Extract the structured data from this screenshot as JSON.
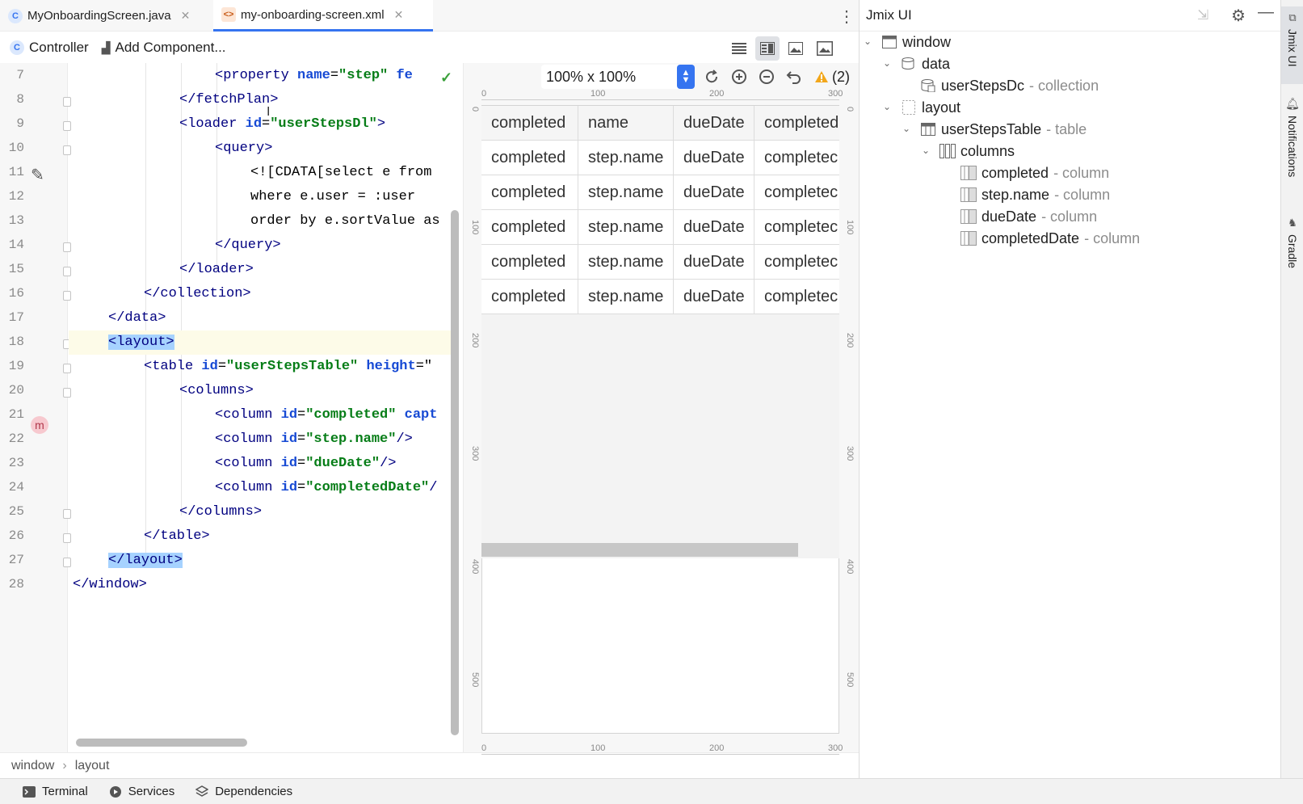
{
  "tabs": [
    {
      "label": "MyOnboardingScreen.java",
      "icon": "java-class-icon"
    },
    {
      "label": "my-onboarding-screen.xml",
      "icon": "xml-file-icon"
    }
  ],
  "toolbar": {
    "controller_label": "Controller",
    "add_component_label": "Add Component..."
  },
  "line_numbers": [
    "7",
    "8",
    "9",
    "10",
    "11",
    "12",
    "13",
    "14",
    "15",
    "16",
    "17",
    "18",
    "19",
    "20",
    "21",
    "22",
    "23",
    "24",
    "25",
    "26",
    "27",
    "28"
  ],
  "code": [
    {
      "indent": "    ",
      "parts": [
        [
          "tg",
          "<property "
        ],
        [
          "at",
          "name"
        ],
        [
          "tx",
          "="
        ],
        [
          "av",
          "\"step\""
        ],
        [
          "tx",
          " "
        ],
        [
          "at",
          "fe"
        ]
      ]
    },
    {
      "indent": "   ",
      "parts": [
        [
          "tg",
          "</fetchPlan>"
        ]
      ]
    },
    {
      "indent": "   ",
      "parts": [
        [
          "tg",
          "<loader "
        ],
        [
          "at",
          "id"
        ],
        [
          "tx",
          "="
        ],
        [
          "av",
          "\"userStepsDl\""
        ],
        [
          "tg",
          ">"
        ]
      ]
    },
    {
      "indent": "    ",
      "parts": [
        [
          "tg",
          "<query>"
        ]
      ]
    },
    {
      "indent": "     ",
      "parts": [
        [
          "tx",
          "<![CDATA[select e from"
        ]
      ]
    },
    {
      "indent": "     ",
      "parts": [
        [
          "tx",
          "where e.user = :user"
        ]
      ]
    },
    {
      "indent": "     ",
      "parts": [
        [
          "tx",
          "order by e.sortValue as"
        ]
      ]
    },
    {
      "indent": "    ",
      "parts": [
        [
          "tg",
          "</query>"
        ]
      ]
    },
    {
      "indent": "   ",
      "parts": [
        [
          "tg",
          "</loader>"
        ]
      ]
    },
    {
      "indent": "  ",
      "parts": [
        [
          "tg",
          "</collection>"
        ]
      ]
    },
    {
      "indent": " ",
      "parts": [
        [
          "tg",
          "</data>"
        ]
      ]
    },
    {
      "indent": " ",
      "parts": [
        [
          "tg",
          "<layout>"
        ]
      ]
    },
    {
      "indent": "  ",
      "parts": [
        [
          "tg",
          "<table "
        ],
        [
          "at",
          "id"
        ],
        [
          "tx",
          "="
        ],
        [
          "av",
          "\"userStepsTable\""
        ],
        [
          "tx",
          " "
        ],
        [
          "at",
          "height"
        ],
        [
          "tx",
          "=\""
        ]
      ]
    },
    {
      "indent": "   ",
      "parts": [
        [
          "tg",
          "<columns>"
        ]
      ]
    },
    {
      "indent": "    ",
      "parts": [
        [
          "tg",
          "<column "
        ],
        [
          "at",
          "id"
        ],
        [
          "tx",
          "="
        ],
        [
          "av",
          "\"completed\""
        ],
        [
          "tx",
          " "
        ],
        [
          "at",
          "capt"
        ]
      ]
    },
    {
      "indent": "    ",
      "parts": [
        [
          "tg",
          "<column "
        ],
        [
          "at",
          "id"
        ],
        [
          "tx",
          "="
        ],
        [
          "av",
          "\"step.name\""
        ],
        [
          "tg",
          "/>"
        ]
      ]
    },
    {
      "indent": "    ",
      "parts": [
        [
          "tg",
          "<column "
        ],
        [
          "at",
          "id"
        ],
        [
          "tx",
          "="
        ],
        [
          "av",
          "\"dueDate\""
        ],
        [
          "tg",
          "/>"
        ]
      ]
    },
    {
      "indent": "    ",
      "parts": [
        [
          "tg",
          "<column "
        ],
        [
          "at",
          "id"
        ],
        [
          "tx",
          "="
        ],
        [
          "av",
          "\"completedDate\""
        ],
        [
          "tg",
          "/"
        ]
      ]
    },
    {
      "indent": "   ",
      "parts": [
        [
          "tg",
          "</columns>"
        ]
      ]
    },
    {
      "indent": "  ",
      "parts": [
        [
          "tg",
          "</table>"
        ]
      ]
    },
    {
      "indent": " ",
      "parts": [
        [
          "tg",
          "</layout>"
        ]
      ]
    },
    {
      "indent": "",
      "parts": [
        [
          "tg",
          "</window>"
        ]
      ]
    }
  ],
  "preview": {
    "zoom_value": "100% x 100%",
    "warnings": "(2)",
    "ruler_h": [
      "0",
      "100",
      "200",
      "300"
    ],
    "ruler_v": [
      "0",
      "100",
      "200",
      "300",
      "400",
      "500"
    ],
    "table_header": [
      "completed",
      "name",
      "dueDate",
      "completedI"
    ],
    "table_rows": [
      [
        "completed",
        "step.name",
        "dueDate",
        "completec"
      ],
      [
        "completed",
        "step.name",
        "dueDate",
        "completec"
      ],
      [
        "completed",
        "step.name",
        "dueDate",
        "completec"
      ],
      [
        "completed",
        "step.name",
        "dueDate",
        "completec"
      ],
      [
        "completed",
        "step.name",
        "dueDate",
        "completec"
      ]
    ]
  },
  "breadcrumb": [
    "window",
    "layout"
  ],
  "bottom_tools": [
    {
      "label": "Terminal",
      "icon": "terminal-icon"
    },
    {
      "label": "Services",
      "icon": "services-icon"
    },
    {
      "label": "Dependencies",
      "icon": "dependencies-icon"
    }
  ],
  "panel": {
    "title": "Jmix UI",
    "tree": [
      {
        "label": "window",
        "sub": "",
        "level": 0,
        "expanded": true,
        "icon": "window-icon"
      },
      {
        "label": "data",
        "sub": "",
        "level": 1,
        "expanded": true,
        "icon": "data-icon"
      },
      {
        "label": "userStepsDc",
        "sub": " - collection",
        "level": 2,
        "expanded": null,
        "icon": "collection-icon"
      },
      {
        "label": "layout",
        "sub": "",
        "level": 1,
        "expanded": true,
        "icon": "layout-icon"
      },
      {
        "label": "userStepsTable",
        "sub": " - table",
        "level": 2,
        "expanded": true,
        "icon": "table-icon"
      },
      {
        "label": "columns",
        "sub": "",
        "level": 3,
        "expanded": true,
        "icon": "columns-icon"
      },
      {
        "label": "completed",
        "sub": " - column",
        "level": 4,
        "expanded": null,
        "icon": "column-icon"
      },
      {
        "label": "step.name",
        "sub": " - column",
        "level": 4,
        "expanded": null,
        "icon": "column-icon"
      },
      {
        "label": "dueDate",
        "sub": " - column",
        "level": 4,
        "expanded": null,
        "icon": "column-icon"
      },
      {
        "label": "completedDate",
        "sub": " - column",
        "level": 4,
        "expanded": null,
        "icon": "column-icon"
      }
    ]
  },
  "side_tabs": [
    {
      "label": "Jmix UI",
      "icon": "jmix-icon"
    },
    {
      "label": "Notifications",
      "icon": "bell-icon"
    },
    {
      "label": "Gradle",
      "icon": "gradle-icon"
    }
  ],
  "colors": {
    "accent": "#3574f0",
    "tag": "#000080",
    "attr": "#174ad4",
    "value": "#067d17",
    "selection": "#a6d2ff"
  }
}
